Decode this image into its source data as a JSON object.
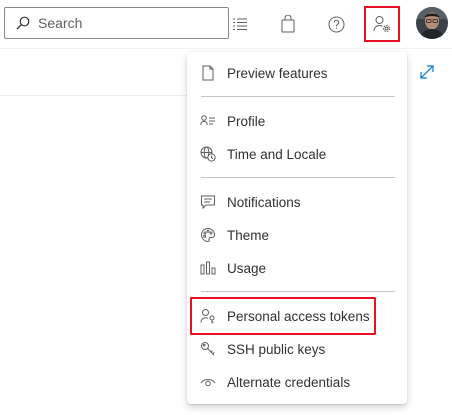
{
  "search": {
    "placeholder": "Search"
  },
  "toolbar": {
    "icons": [
      "list-icon",
      "shopping-bag-icon",
      "help-icon",
      "user-settings-icon"
    ],
    "highlight_color": "#e81123"
  },
  "user": {
    "avatar_icon": "avatar-photo"
  },
  "menu": {
    "groups": [
      {
        "items": [
          {
            "label": "Preview features",
            "icon": "document-icon"
          }
        ]
      },
      {
        "items": [
          {
            "label": "Profile",
            "icon": "contact-card-icon"
          },
          {
            "label": "Time and Locale",
            "icon": "globe-clock-icon"
          }
        ]
      },
      {
        "items": [
          {
            "label": "Notifications",
            "icon": "comment-icon"
          },
          {
            "label": "Theme",
            "icon": "palette-icon"
          },
          {
            "label": "Usage",
            "icon": "bar-chart-icon"
          }
        ]
      },
      {
        "items": [
          {
            "label": "Personal access tokens",
            "icon": "user-key-icon"
          },
          {
            "label": "SSH public keys",
            "icon": "key-icon"
          },
          {
            "label": "Alternate credentials",
            "icon": "eye-icon"
          }
        ]
      }
    ]
  },
  "colors": {
    "accent": "#0078d4",
    "text": "#323130",
    "divider": "#c8c6c4"
  }
}
